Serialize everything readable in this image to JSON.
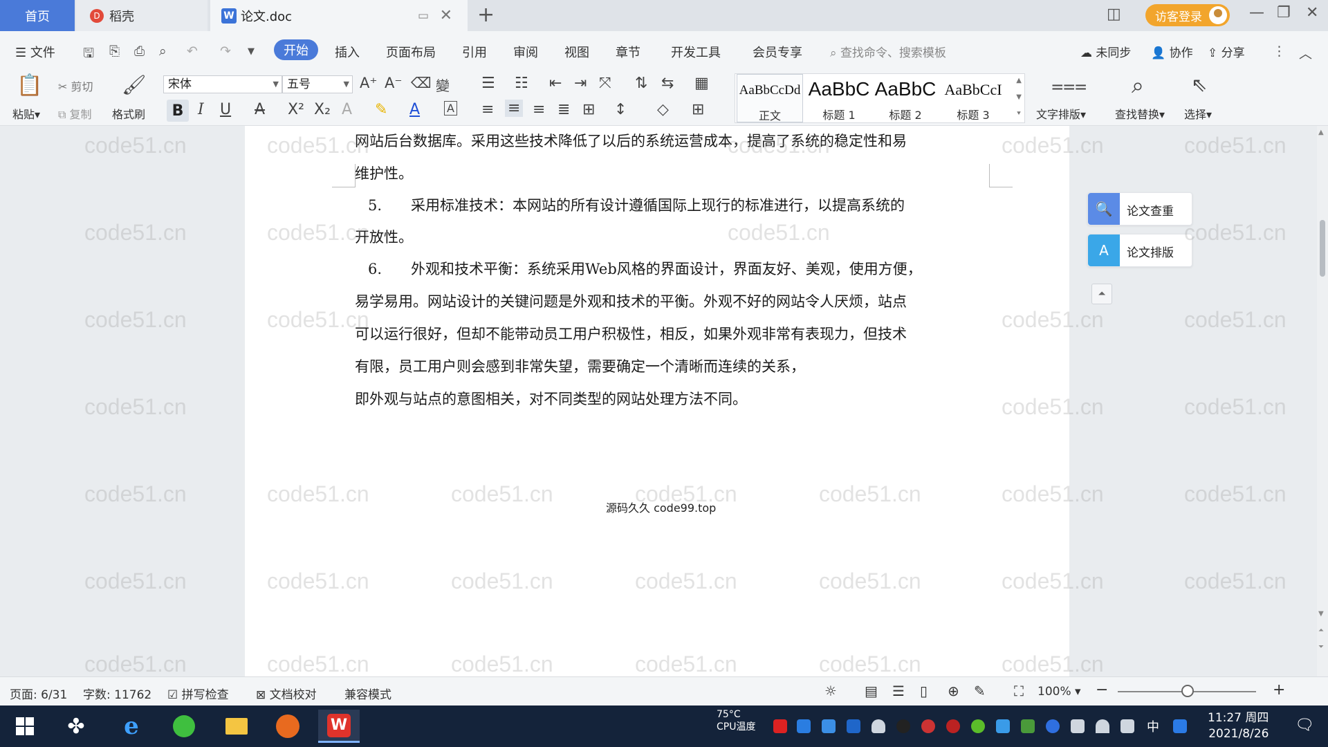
{
  "tabs": {
    "home": "首页",
    "daoke": "稻壳",
    "doc": "论文.doc"
  },
  "login": "访客登录",
  "menu": {
    "file": "文件",
    "items": [
      "开始",
      "插入",
      "页面布局",
      "引用",
      "审阅",
      "视图",
      "章节",
      "开发工具",
      "会员专享"
    ],
    "search_placeholder": "查找命令、搜索模板",
    "unsynced": "未同步",
    "collab": "协作",
    "share": "分享"
  },
  "ribbon": {
    "paste": "粘贴",
    "cut": "剪切",
    "copy": "复制",
    "format_painter": "格式刷",
    "font_name": "宋体",
    "font_size": "五号",
    "styles": [
      {
        "sample": "AaBbCcDd",
        "label": "正文"
      },
      {
        "sample": "AaBbC",
        "label": "标题 1"
      },
      {
        "sample": "AaBbC",
        "label": "标题 2"
      },
      {
        "sample": "AaBbCcI",
        "label": "标题 3"
      }
    ],
    "text_layout": "文字排版",
    "find_replace": "查找替换",
    "select": "选择"
  },
  "document": {
    "lines": [
      "网站后台数据库。采用这些技术降低了以后的系统运营成本，提高了系统的稳定性和易",
      "维护性。",
      "5.　　采用标准技术：本网站的所有设计遵循国际上现行的标准进行，以提高系统的",
      "开放性。",
      "6.　　外观和技术平衡：系统采用Web风格的界面设计，界面友好、美观，使用方便，",
      "易学易用。网站设计的关键问题是外观和技术的平衡。外观不好的网站令人厌烦，站点",
      "可以运行很好，但却不能带动员工用户积极性，相反，如果外观非常有表现力，但技术",
      "有限，员工用户则会感到非常失望，需要确定一个清晰而连续的关系，",
      "即外观与站点的意图相关，对不同类型的网站处理方法不同。"
    ],
    "overlay_text": "源码久久 code99.top",
    "watermark": "code51.cn"
  },
  "side_panel": {
    "check": "论文查重",
    "layout": "论文排版"
  },
  "status": {
    "page": "页面: 6/31",
    "words": "字数: 11762",
    "spell": "拼写检查",
    "proof": "文档校对",
    "compat": "兼容模式",
    "zoom": "100%"
  },
  "taskbar": {
    "temp_value": "75°C",
    "temp_label": "CPU温度",
    "ime": "中",
    "time": "11:27 周四",
    "date": "2021/8/26"
  }
}
